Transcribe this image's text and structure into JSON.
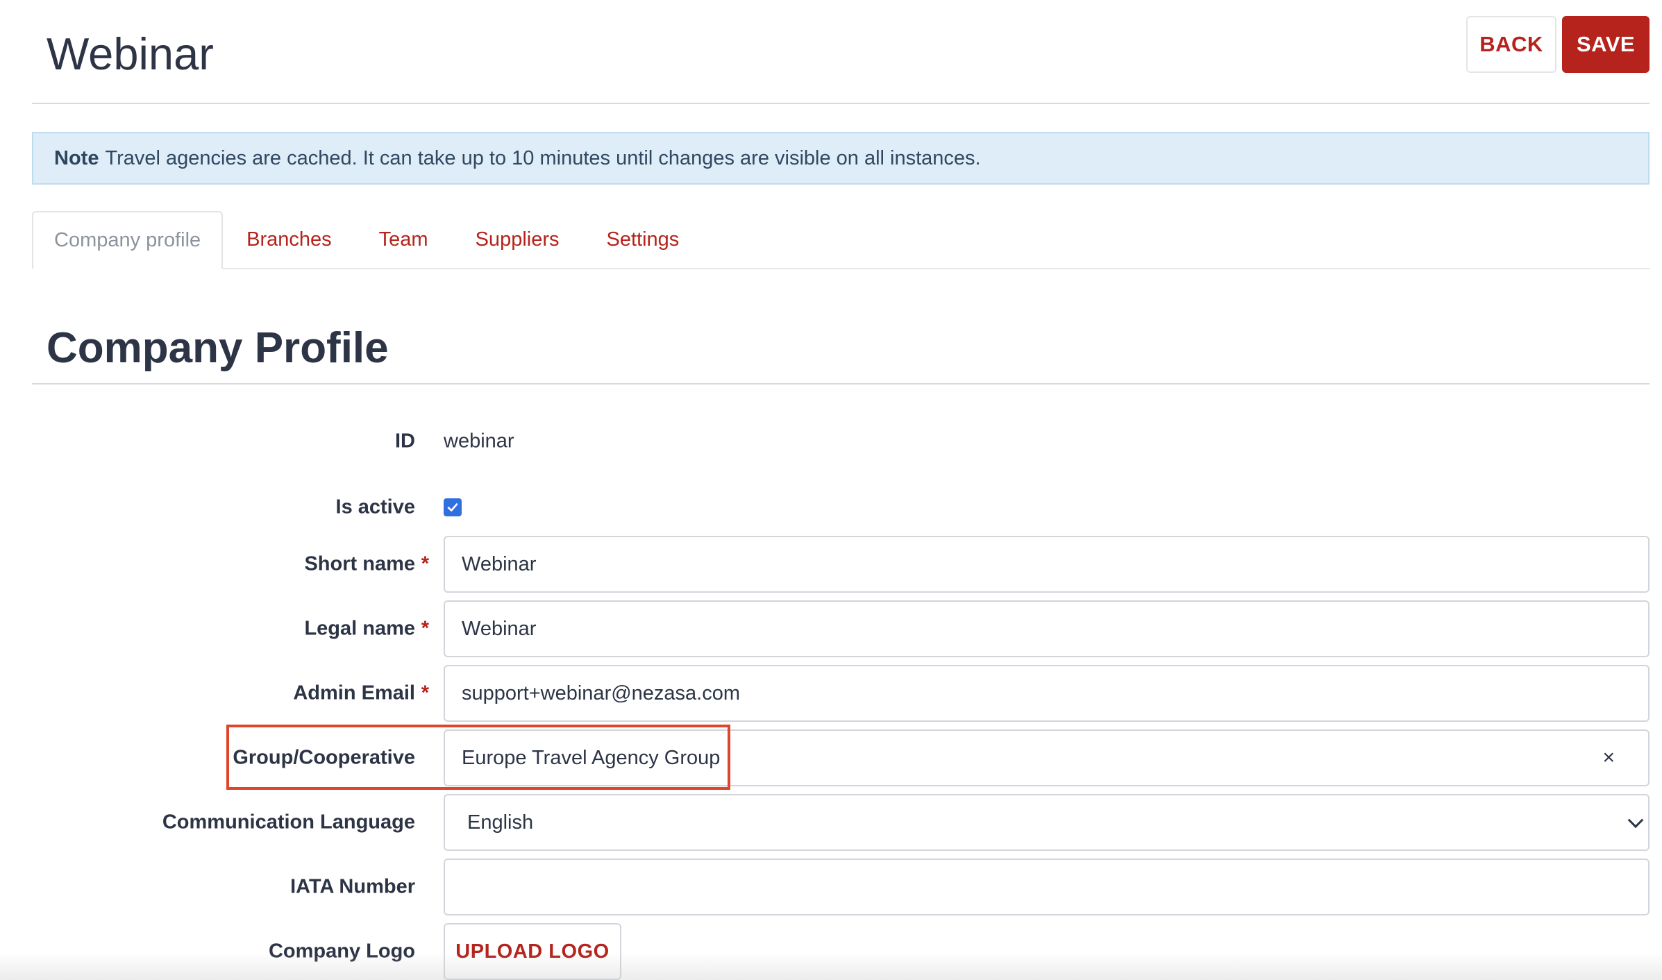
{
  "header": {
    "title": "Webinar",
    "back_label": "BACK",
    "save_label": "SAVE"
  },
  "note": {
    "prefix": "Note",
    "text": "Travel agencies are cached. It can take up to 10 minutes until changes are visible on all instances."
  },
  "tabs": [
    {
      "label": "Company profile",
      "active": true
    },
    {
      "label": "Branches",
      "active": false
    },
    {
      "label": "Team",
      "active": false
    },
    {
      "label": "Suppliers",
      "active": false
    },
    {
      "label": "Settings",
      "active": false
    }
  ],
  "section": {
    "title": "Company Profile"
  },
  "form": {
    "id": {
      "label": "ID",
      "value": "webinar"
    },
    "is_active": {
      "label": "Is active",
      "checked": true
    },
    "short_name": {
      "label": "Short name",
      "value": "Webinar",
      "required_mark": "*"
    },
    "legal_name": {
      "label": "Legal name",
      "value": "Webinar",
      "required_mark": "*"
    },
    "admin_email": {
      "label": "Admin Email",
      "value": "support+webinar@nezasa.com",
      "required_mark": "*"
    },
    "group": {
      "label": "Group/Cooperative",
      "value": "Europe Travel Agency Group",
      "clear": "×"
    },
    "language": {
      "label": "Communication Language",
      "value": "English"
    },
    "iata": {
      "label": "IATA Number",
      "value": ""
    },
    "logo": {
      "label": "Company Logo",
      "button": "UPLOAD LOGO"
    }
  },
  "colors": {
    "accent": "#b5231c",
    "note_bg": "#deedf7",
    "highlight": "#e0452c",
    "checkbox": "#2f6fdf"
  }
}
